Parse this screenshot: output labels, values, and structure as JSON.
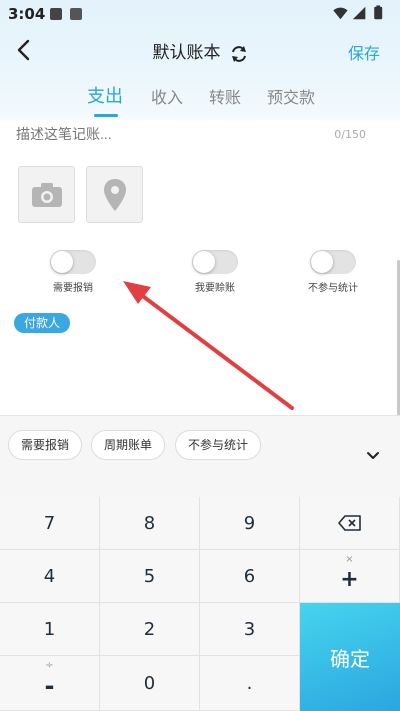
{
  "status_bar": {
    "time": "3:04"
  },
  "nav": {
    "back_label": "",
    "title": "默认账本",
    "save_label": "保存"
  },
  "tabs": [
    {
      "label": "支出",
      "active": true
    },
    {
      "label": "收入",
      "active": false
    },
    {
      "label": "转账",
      "active": false
    },
    {
      "label": "预交款",
      "active": false
    }
  ],
  "description": {
    "placeholder": "描述这笔记账...",
    "counter": "0/150"
  },
  "attachments": [
    {
      "icon": "camera-icon"
    },
    {
      "icon": "location-pin-icon"
    }
  ],
  "toggles": [
    {
      "label": "需要报销",
      "on": false
    },
    {
      "label": "我要赊账",
      "on": false
    },
    {
      "label": "不参与统计",
      "on": false
    }
  ],
  "payer_tag": "付款人",
  "quick_chips": [
    "需要报销",
    "周期账单",
    "不参与统计"
  ],
  "keypad": {
    "row1": [
      "7",
      "8",
      "9"
    ],
    "row2": [
      "4",
      "5",
      "6"
    ],
    "row3": [
      "1",
      "2",
      "3"
    ],
    "row4": [
      "0",
      "."
    ],
    "plus": "+",
    "plus_sub": "×",
    "minus": "-",
    "minus_sub": "÷",
    "confirm": "确定"
  },
  "colors": {
    "accent": "#2aa6dd",
    "tag": "#3aa7e0",
    "arrow": "#e04040",
    "confirm_start": "#47d4ee",
    "confirm_end": "#2aa6e0"
  }
}
